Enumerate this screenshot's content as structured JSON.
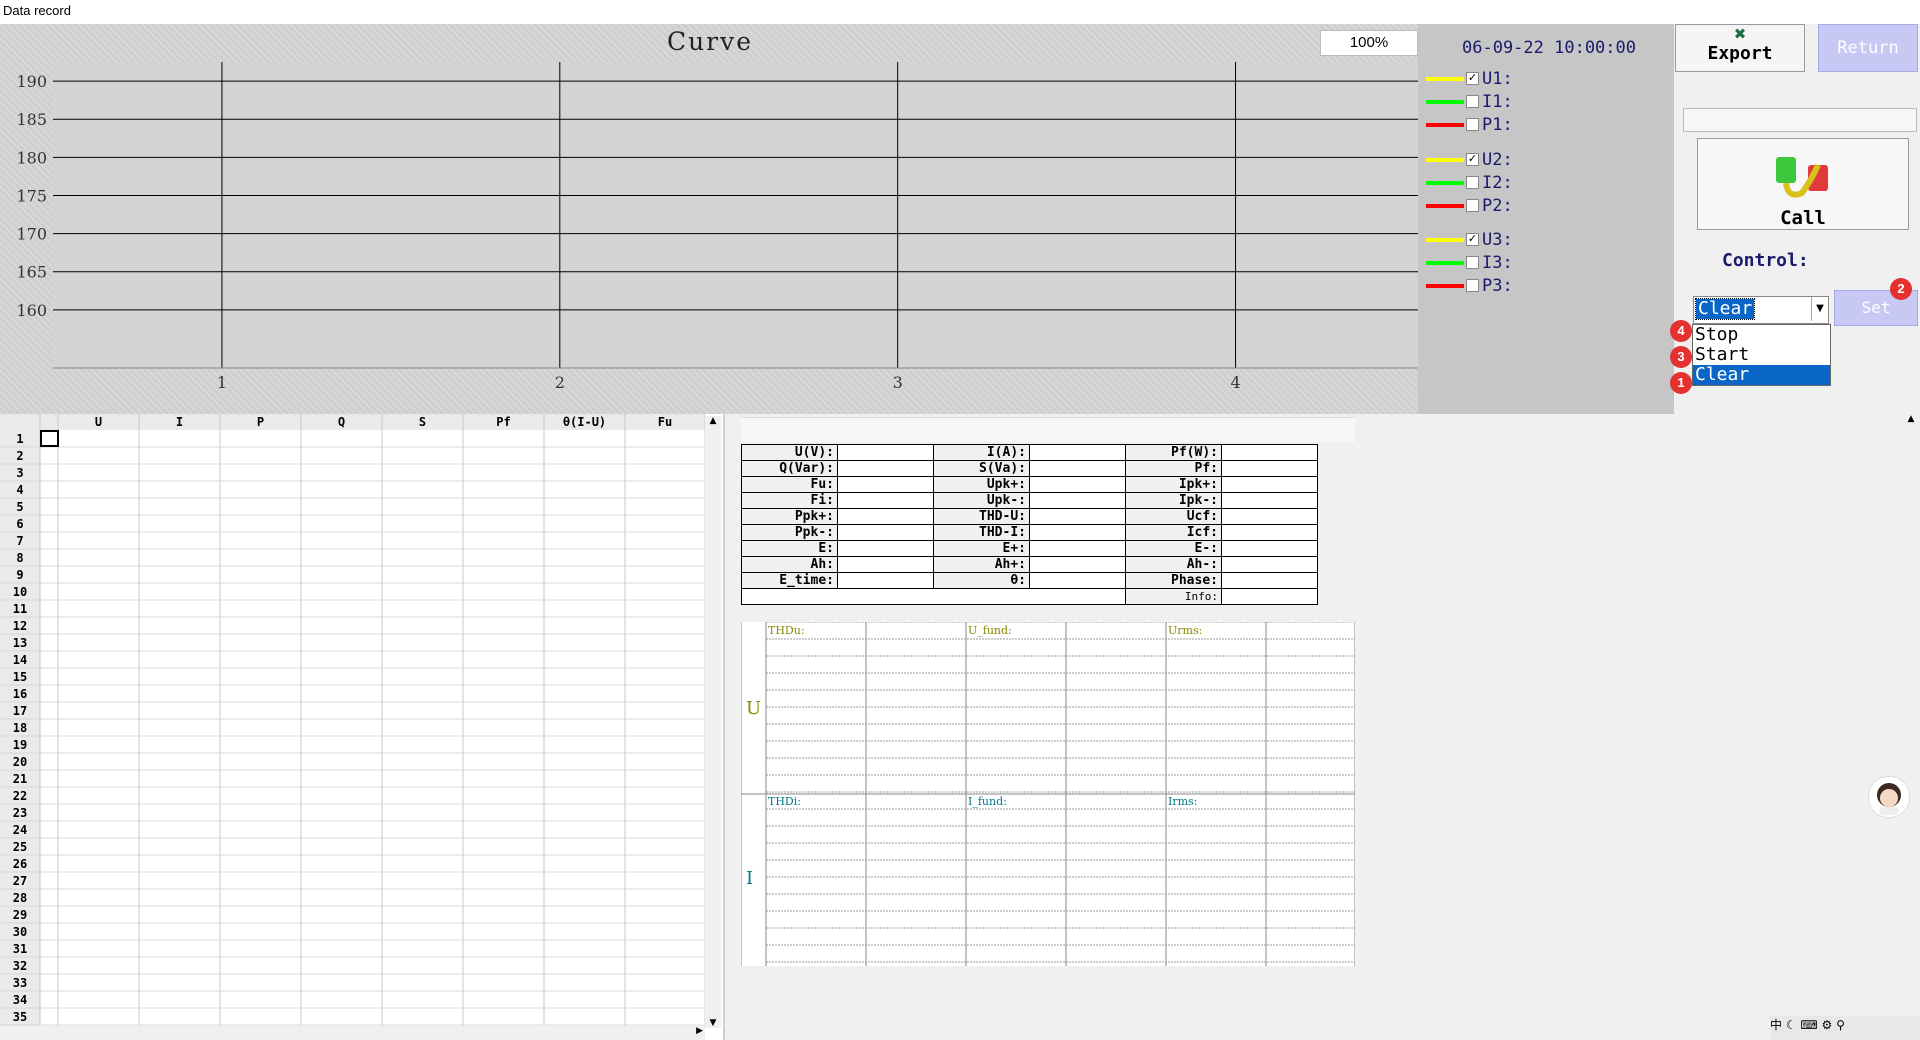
{
  "window_title": "Data record",
  "chart": {
    "title": "Curve",
    "zoom": "100%",
    "y_ticks": [
      "190",
      "185",
      "180",
      "175",
      "170",
      "165",
      "160"
    ],
    "x_ticks": [
      "1",
      "2",
      "3",
      "4"
    ]
  },
  "chart_data": {
    "type": "line",
    "title": "Curve",
    "y_ticks": [
      190,
      185,
      180,
      175,
      170,
      165,
      160
    ],
    "x_ticks": [
      1,
      2,
      3,
      4
    ],
    "grid": true,
    "series": []
  },
  "legend": {
    "timestamp": "06-09-22 10:00:00",
    "items": [
      {
        "label": "U1:",
        "color": "#ffff00",
        "checked": true
      },
      {
        "label": "I1:",
        "color": "#00ff00",
        "checked": false
      },
      {
        "label": "P1:",
        "color": "#ff0000",
        "checked": false
      },
      {
        "label": "U2:",
        "color": "#ffff00",
        "checked": true
      },
      {
        "label": "I2:",
        "color": "#00ff00",
        "checked": false
      },
      {
        "label": "P2:",
        "color": "#ff0000",
        "checked": false
      },
      {
        "label": "U3:",
        "color": "#ffff00",
        "checked": true
      },
      {
        "label": "I3:",
        "color": "#00ff00",
        "checked": false
      },
      {
        "label": "P3:",
        "color": "#ff0000",
        "checked": false
      }
    ]
  },
  "controls": {
    "export_label": "Export",
    "return_label": "Return",
    "call_label": "Call",
    "control_label": "Control:",
    "select_value": "Clear",
    "set_label": "Set",
    "dropdown_options": [
      "Stop",
      "Start",
      "Clear"
    ],
    "badges": [
      "1",
      "2",
      "3",
      "4"
    ]
  },
  "grid": {
    "columns": [
      "U",
      "I",
      "P",
      "Q",
      "S",
      "Pf",
      "θ(I-U)",
      "Fu"
    ],
    "rows": [
      "1",
      "2",
      "3",
      "4",
      "5",
      "6",
      "7",
      "8",
      "9",
      "10",
      "11",
      "12",
      "13",
      "14",
      "15",
      "16",
      "17",
      "18",
      "19",
      "20",
      "21",
      "22",
      "23",
      "24",
      "25",
      "26",
      "27",
      "28",
      "29",
      "30",
      "31",
      "32",
      "33",
      "34",
      "35"
    ]
  },
  "measurements": {
    "rows": [
      [
        "U(V):",
        "I(A):",
        "Pf(W):"
      ],
      [
        "Q(Var):",
        "S(Va):",
        "Pf:"
      ],
      [
        "Fu:",
        "Upk+:",
        "Ipk+:"
      ],
      [
        "Fi:",
        "Upk-:",
        "Ipk-:"
      ],
      [
        "Ppk+:",
        "THD-U:",
        "Ucf:"
      ],
      [
        "Ppk-:",
        "THD-I:",
        "Icf:"
      ],
      [
        "E:",
        "E+:",
        "E-:"
      ],
      [
        "Ah:",
        "Ah+:",
        "Ah-:"
      ],
      [
        "E_time:",
        "θ:",
        "Phase:"
      ]
    ],
    "info_label": "Info:"
  },
  "harmonics": {
    "u_label": "U",
    "i_label": "I",
    "u_headers": [
      "THDu:",
      "U_fund:",
      "Urms:"
    ],
    "i_headers": [
      "THDi:",
      "I_fund:",
      "Irms:"
    ]
  },
  "colors": {
    "u_label": "#8a8a00",
    "i_label": "#007a8a"
  }
}
